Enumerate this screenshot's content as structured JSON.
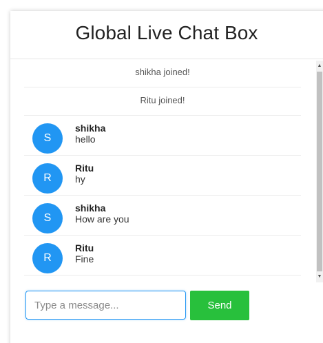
{
  "header": {
    "title": "Global Live Chat Box"
  },
  "messages": [
    {
      "type": "system",
      "text": "shikha joined!"
    },
    {
      "type": "system",
      "text": "Ritu joined!"
    },
    {
      "type": "chat",
      "initial": "S",
      "user": "shikha",
      "text": "hello"
    },
    {
      "type": "chat",
      "initial": "R",
      "user": "Ritu",
      "text": "hy"
    },
    {
      "type": "chat",
      "initial": "S",
      "user": "shikha",
      "text": "How are you"
    },
    {
      "type": "chat",
      "initial": "R",
      "user": "Ritu",
      "text": "Fine"
    }
  ],
  "scrollbar": {
    "up_arrow": "▲",
    "down_arrow": "▼"
  },
  "composer": {
    "placeholder": "Type a message...",
    "value": "",
    "send_label": "Send"
  },
  "colors": {
    "avatar": "#2196f3",
    "send_button": "#28c03c",
    "input_border": "#2196f3"
  }
}
